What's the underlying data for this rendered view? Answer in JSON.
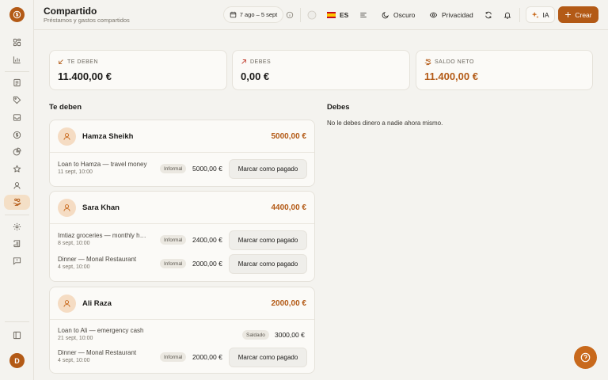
{
  "header": {
    "title": "Compartido",
    "subtitle": "Préstamos y gastos compartidos"
  },
  "toolbar": {
    "date_range": "7 ago – 5 sept",
    "lang": "ES",
    "theme": "Oscuro",
    "privacy": "Privacidad",
    "ai": "IA",
    "create": "Crear"
  },
  "stats": [
    {
      "label": "TE DEBEN",
      "value": "11.400,00 €"
    },
    {
      "label": "DEBES",
      "value": "0,00 €"
    },
    {
      "label": "SALDO NETO",
      "value": "11.400,00 €"
    }
  ],
  "sections": {
    "owed_to_me": "Te deben",
    "i_owe": "Debes",
    "i_owe_empty": "No le debes dinero a nadie ahora mismo."
  },
  "people": [
    {
      "name": "Hamza Sheikh",
      "total": "5000,00 €",
      "rows": [
        {
          "desc": "Loan to Hamza — travel money",
          "date": "11 sept, 10:00",
          "badge": "Informal",
          "amount": "5000,00 €",
          "action": "Marcar como pagado"
        }
      ]
    },
    {
      "name": "Sara Khan",
      "total": "4400,00 €",
      "rows": [
        {
          "desc": "Imtiaz groceries — monthly h…",
          "date": "8 sept, 10:00",
          "badge": "Informal",
          "amount": "2400,00 €",
          "action": "Marcar como pagado"
        },
        {
          "desc": "Dinner — Monal Restaurant",
          "date": "4 sept, 10:00",
          "badge": "Informal",
          "amount": "2000,00 €",
          "action": "Marcar como pagado"
        }
      ]
    },
    {
      "name": "Ali Raza",
      "total": "2000,00 €",
      "rows": [
        {
          "desc": "Loan to Ali — emergency cash",
          "date": "21 sept, 10:00",
          "badge": "Saldado",
          "amount": "3000,00 €",
          "action": ""
        },
        {
          "desc": "Dinner — Monal Restaurant",
          "date": "4 sept, 10:00",
          "badge": "Informal",
          "amount": "2000,00 €",
          "action": "Marcar como pagado"
        }
      ]
    }
  ],
  "user": {
    "initial": "D"
  },
  "colors": {
    "accent": "#b35a16",
    "background": "#f4f3ef",
    "card": "#fbfaf7"
  }
}
